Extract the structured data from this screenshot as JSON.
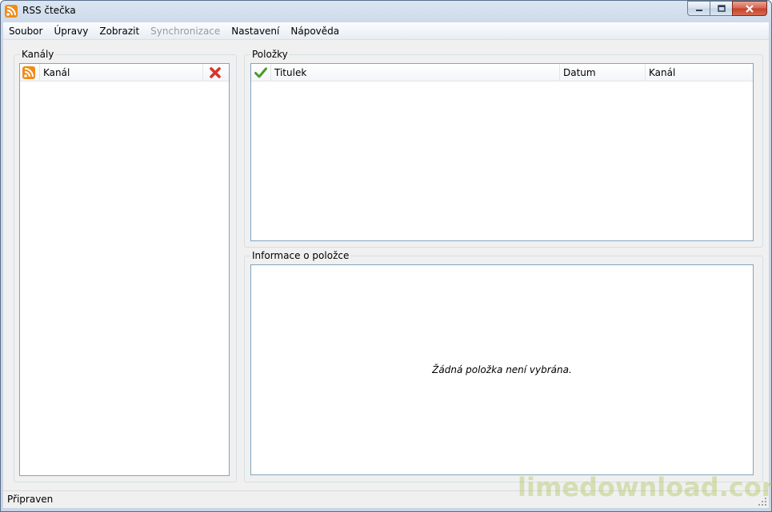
{
  "window": {
    "title": "RSS čtečka",
    "icon": "rss-icon"
  },
  "menu": {
    "items": [
      {
        "label": "Soubor",
        "enabled": true
      },
      {
        "label": "Úpravy",
        "enabled": true
      },
      {
        "label": "Zobrazit",
        "enabled": true
      },
      {
        "label": "Synchronizace",
        "enabled": false
      },
      {
        "label": "Nastavení",
        "enabled": true
      },
      {
        "label": "Nápověda",
        "enabled": true
      }
    ]
  },
  "channels": {
    "group_label": "Kanály",
    "header": {
      "icon": "rss-icon",
      "label": "Kanál",
      "action_icon": "delete-icon"
    }
  },
  "items": {
    "group_label": "Položky",
    "columns": [
      {
        "icon": "checkmark-icon",
        "label": "Titulek"
      },
      {
        "label": "Datum"
      },
      {
        "label": "Kanál"
      }
    ]
  },
  "detail": {
    "group_label": "Informace o položce",
    "empty_message": "Žádná položka není vybrána."
  },
  "status": {
    "text": "Připraven"
  },
  "watermark": "limedownload.com",
  "colors": {
    "rss_orange": "#f08c1a",
    "delete_red": "#d9342b",
    "check_green": "#4a9a2b",
    "list_border": "#82a5c0"
  }
}
